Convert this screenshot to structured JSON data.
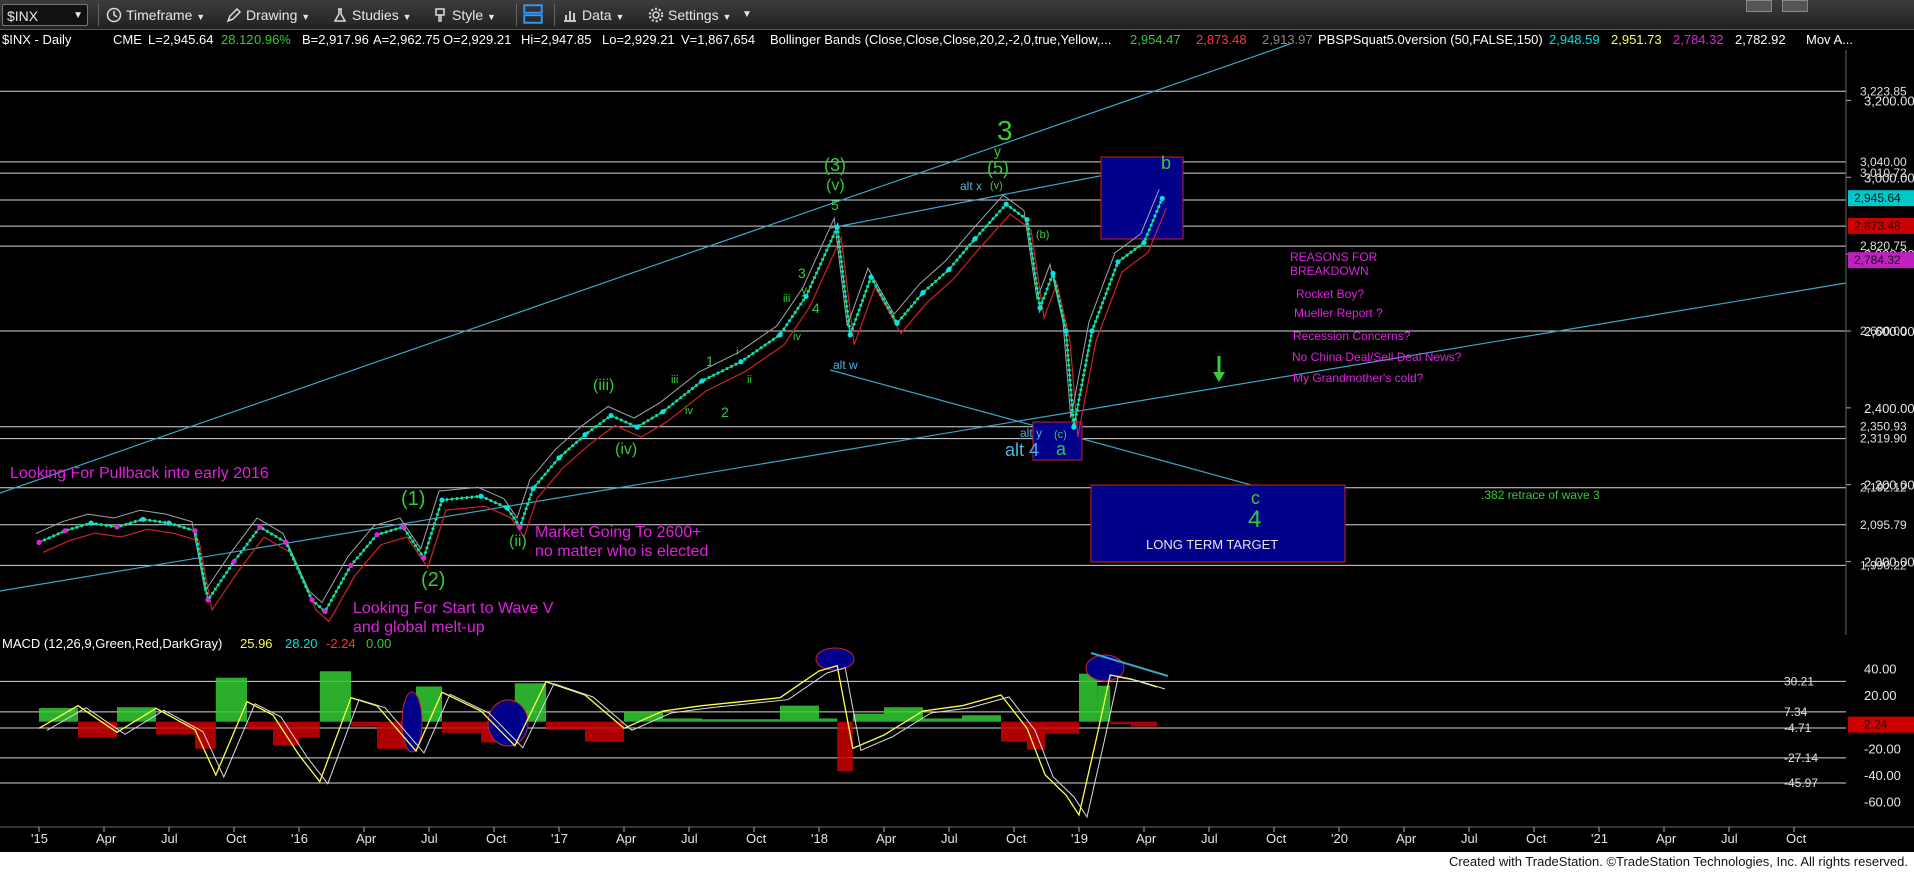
{
  "toolbar": {
    "symbol": "$INX",
    "timeframe": "Timeframe",
    "drawing": "Drawing",
    "studies": "Studies",
    "style": "Style",
    "data": "Data",
    "settings": "Settings"
  },
  "header": {
    "symbol": "$INX - Daily",
    "exchange": "CME",
    "last": "L=2,945.64",
    "change": "28.12",
    "pct": "0.96%",
    "bid": "B=2,917.96",
    "ask": "A=2,962.75",
    "open": "O=2,929.21",
    "high": "Hi=2,947.85",
    "low": "Lo=2,929.21",
    "volume": "V=1,867,654",
    "bb_label": "Bollinger Bands (Close,Close,Close,20,2,-2,0,true,Yellow,...",
    "bb_v1": "2,954.47",
    "bb_v2": "2,873.48",
    "bb_v3": "2,913.97",
    "pbs_label": "PBSPSquat5.0version (50,FALSE,150)",
    "pbs_v1": "2,948.59",
    "pbs_v2": "2,951.73",
    "pbs_v3": "2,784.32",
    "pbs_v4": "2,782.92",
    "mov": "Mov A..."
  },
  "macd_header": {
    "label": "MACD (12,26,9,Green,Red,DarkGray)",
    "v1": "25.96",
    "v2": "28.20",
    "v3": "-2.24",
    "v4": "0.00"
  },
  "footer": "Created with TradeStation. ©TradeStation Technologies, Inc. All rights reserved.",
  "colors": {
    "price_line": "#00e5e5",
    "wave_label": "#33cc33",
    "annotation": "#e020e0",
    "target_box": "#00008b",
    "level_line": "#dcdcdc"
  },
  "chart_data": {
    "type": "line",
    "title": "$INX - Daily",
    "price_axis": {
      "ylim": [
        1900,
        3300
      ],
      "ticks": [
        "3,200.00",
        "3,000.00",
        "2,800.00",
        "2,600.00",
        "2,400.00",
        "2,200.00",
        "2,000.00"
      ]
    },
    "x_tick_labels": [
      "'15",
      "Apr",
      "Jul",
      "Oct",
      "'16",
      "Apr",
      "Jul",
      "Oct",
      "'17",
      "Apr",
      "Jul",
      "Oct",
      "'18",
      "Apr",
      "Jul",
      "Oct",
      "'19",
      "Apr",
      "Jul",
      "Oct",
      "'20",
      "Apr",
      "Jul",
      "Oct",
      "'21",
      "Apr",
      "Jul",
      "Oct"
    ],
    "horizontal_levels": [
      {
        "value": 3223.85,
        "label": "3,223.85"
      },
      {
        "value": 3040.0,
        "label": "3,040.00"
      },
      {
        "value": 3010.72,
        "label": "3,010.72"
      },
      {
        "value": 2941.0,
        "label": "2,941.00"
      },
      {
        "value": 2873.0,
        "label": "2,873.00"
      },
      {
        "value": 2820.75,
        "label": "2,820.75"
      },
      {
        "value": 2600.0,
        "label": "2,600.00"
      },
      {
        "value": 2350.93,
        "label": "2,350.93"
      },
      {
        "value": 2319.9,
        "label": "2,319.90"
      },
      {
        "value": 2192.12,
        "label": "2,192.12"
      },
      {
        "value": 2095.79,
        "label": "2,095.79"
      },
      {
        "value": 1990.22,
        "label": "1,990.22"
      }
    ],
    "price_tags": [
      {
        "value": 2945.64,
        "label": "2,945.64",
        "color": "#00c8c8"
      },
      {
        "value": 2873.48,
        "label": "2,873.48",
        "color": "#cc0000"
      },
      {
        "value": 2784.32,
        "label": "2,784.32",
        "color": "#c020c0"
      }
    ],
    "series": [
      {
        "name": "$INX",
        "points": [
          [
            2015.0,
            2050
          ],
          [
            2015.1,
            2080
          ],
          [
            2015.2,
            2100
          ],
          [
            2015.3,
            2090
          ],
          [
            2015.4,
            2110
          ],
          [
            2015.5,
            2100
          ],
          [
            2015.6,
            2080
          ],
          [
            2015.65,
            1900
          ],
          [
            2015.75,
            2000
          ],
          [
            2015.85,
            2090
          ],
          [
            2015.95,
            2050
          ],
          [
            2016.05,
            1900
          ],
          [
            2016.1,
            1870
          ],
          [
            2016.2,
            1990
          ],
          [
            2016.3,
            2070
          ],
          [
            2016.4,
            2090
          ],
          [
            2016.48,
            2010
          ],
          [
            2016.55,
            2160
          ],
          [
            2016.7,
            2170
          ],
          [
            2016.8,
            2140
          ],
          [
            2016.85,
            2090
          ],
          [
            2016.9,
            2190
          ],
          [
            2017.0,
            2270
          ],
          [
            2017.1,
            2330
          ],
          [
            2017.2,
            2380
          ],
          [
            2017.3,
            2350
          ],
          [
            2017.4,
            2390
          ],
          [
            2017.55,
            2470
          ],
          [
            2017.7,
            2520
          ],
          [
            2017.85,
            2590
          ],
          [
            2017.95,
            2690
          ],
          [
            2018.07,
            2870
          ],
          [
            2018.12,
            2590
          ],
          [
            2018.2,
            2740
          ],
          [
            2018.3,
            2620
          ],
          [
            2018.4,
            2700
          ],
          [
            2018.5,
            2760
          ],
          [
            2018.6,
            2840
          ],
          [
            2018.72,
            2930
          ],
          [
            2018.8,
            2890
          ],
          [
            2018.85,
            2660
          ],
          [
            2018.9,
            2750
          ],
          [
            2018.95,
            2600
          ],
          [
            2018.98,
            2350
          ],
          [
            2019.05,
            2600
          ],
          [
            2019.15,
            2780
          ],
          [
            2019.25,
            2830
          ],
          [
            2019.32,
            2945
          ]
        ]
      }
    ],
    "macd_axis": {
      "ylim": [
        -70,
        50
      ],
      "ticks": [
        "40.00",
        "20.00",
        "0.00",
        "-20.00",
        "-40.00",
        "-60.00"
      ]
    },
    "macd_levels": [
      {
        "value": 30.21,
        "label": "30.21"
      },
      {
        "value": 7.34,
        "label": "7.34"
      },
      {
        "value": -4.71,
        "label": "-4.71"
      },
      {
        "value": -27.14,
        "label": "-27.14"
      },
      {
        "value": -45.97,
        "label": "-45.97"
      }
    ],
    "macd_tag": {
      "value": -2.24,
      "label": "-2.24"
    },
    "macd_series": [
      {
        "name": "MACD",
        "points": [
          [
            2015.0,
            -5
          ],
          [
            2015.15,
            12
          ],
          [
            2015.3,
            -8
          ],
          [
            2015.45,
            10
          ],
          [
            2015.6,
            -6
          ],
          [
            2015.68,
            -40
          ],
          [
            2015.8,
            15
          ],
          [
            2015.9,
            5
          ],
          [
            2016.0,
            -25
          ],
          [
            2016.08,
            -45
          ],
          [
            2016.2,
            18
          ],
          [
            2016.3,
            12
          ],
          [
            2016.45,
            -22
          ],
          [
            2016.55,
            22
          ],
          [
            2016.7,
            8
          ],
          [
            2016.83,
            -18
          ],
          [
            2016.95,
            30
          ],
          [
            2017.1,
            20
          ],
          [
            2017.25,
            -5
          ],
          [
            2017.4,
            8
          ],
          [
            2017.55,
            12
          ],
          [
            2017.7,
            15
          ],
          [
            2017.85,
            18
          ],
          [
            2018.0,
            38
          ],
          [
            2018.07,
            42
          ],
          [
            2018.13,
            -20
          ],
          [
            2018.25,
            -10
          ],
          [
            2018.4,
            8
          ],
          [
            2018.55,
            12
          ],
          [
            2018.7,
            20
          ],
          [
            2018.8,
            -5
          ],
          [
            2018.87,
            -40
          ],
          [
            2018.95,
            -55
          ],
          [
            2019.0,
            -70
          ],
          [
            2019.07,
            -10
          ],
          [
            2019.12,
            35
          ],
          [
            2019.2,
            32
          ],
          [
            2019.3,
            26
          ]
        ]
      }
    ],
    "annotations": {
      "title_reasons": "REASONS FOR BREAKDOWN",
      "reasons": [
        "Rocket Boy?",
        "Mueller Report ?",
        "Recession Concerns?",
        "No China Deal/Sell Deal News?",
        "My Grandmother's cold?"
      ],
      "pullback": "Looking For Pullback into early 2016",
      "market_2600_l1": "Market Going To 2600+",
      "market_2600_l2": "no matter who is elected",
      "start_wave_l1": "Looking For Start to Wave V",
      "start_wave_l2": "and global melt-up",
      "retrace": ".382 retrace of wave 3",
      "long_term": "LONG TERM TARGET",
      "waves": {
        "w1": "(1)",
        "w2": "(2)",
        "wii": "(ii)",
        "wiii": "(iii)",
        "wiv": "(iv)",
        "w3big": "3",
        "w5big": "(5)",
        "wv": "(v)",
        "w3p": "(3)",
        "wv2": "(v)",
        "w5": "5",
        "w3s": "3",
        "w4s": "4",
        "wiiis": "iii",
        "wivs": "iv",
        "w1s": "1",
        "w2s": "2",
        "wis": "i",
        "wiis": "ii",
        "wiiis2": "iii",
        "wivs2": "iv",
        "alt_x": "alt x",
        "alt_w": "alt w",
        "alt_y": "alt y",
        "alt4": "alt 4",
        "a": "a",
        "b": "b",
        "c": "c",
        "four": "4",
        "bsmall": "(b)",
        "csmall": "(c)",
        "vsmall": "(v)",
        "y1": "y",
        "y2": "y"
      }
    }
  }
}
